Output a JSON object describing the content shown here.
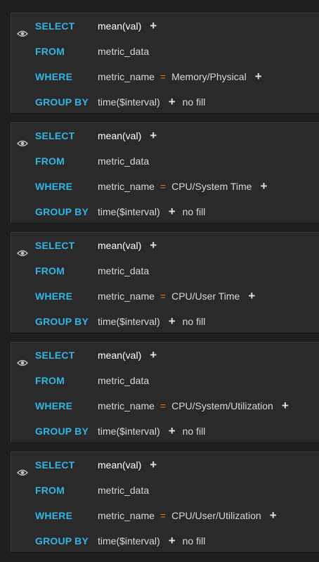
{
  "queries": [
    {
      "select_kw": "SELECT",
      "select_fn": "mean(val)",
      "from_kw": "FROM",
      "from_table": "metric_data",
      "where_kw": "WHERE",
      "where_key": "metric_name",
      "where_op": "=",
      "where_value": "Memory/Physical",
      "group_kw": "GROUP BY",
      "group_by": "time($interval)",
      "fill": "no fill"
    },
    {
      "select_kw": "SELECT",
      "select_fn": "mean(val)",
      "from_kw": "FROM",
      "from_table": "metric_data",
      "where_kw": "WHERE",
      "where_key": "metric_name",
      "where_op": "=",
      "where_value": "CPU/System Time",
      "group_kw": "GROUP BY",
      "group_by": "time($interval)",
      "fill": "no fill"
    },
    {
      "select_kw": "SELECT",
      "select_fn": "mean(val)",
      "from_kw": "FROM",
      "from_table": "metric_data",
      "where_kw": "WHERE",
      "where_key": "metric_name",
      "where_op": "=",
      "where_value": "CPU/User Time",
      "group_kw": "GROUP BY",
      "group_by": "time($interval)",
      "fill": "no fill"
    },
    {
      "select_kw": "SELECT",
      "select_fn": "mean(val)",
      "from_kw": "FROM",
      "from_table": "metric_data",
      "where_kw": "WHERE",
      "where_key": "metric_name",
      "where_op": "=",
      "where_value": "CPU/System/Utilization",
      "group_kw": "GROUP BY",
      "group_by": "time($interval)",
      "fill": "no fill"
    },
    {
      "select_kw": "SELECT",
      "select_fn": "mean(val)",
      "from_kw": "FROM",
      "from_table": "metric_data",
      "where_kw": "WHERE",
      "where_key": "metric_name",
      "where_op": "=",
      "where_value": "CPU/User/Utilization",
      "group_kw": "GROUP BY",
      "group_by": "time($interval)",
      "fill": "no fill"
    }
  ],
  "icons": {
    "eye": "eye-icon",
    "plus": "plus-icon"
  },
  "colors": {
    "keyword": "#33b5e5",
    "operator": "#eb7b18",
    "panel": "#2a2a2a",
    "background": "#1f1f1f"
  }
}
